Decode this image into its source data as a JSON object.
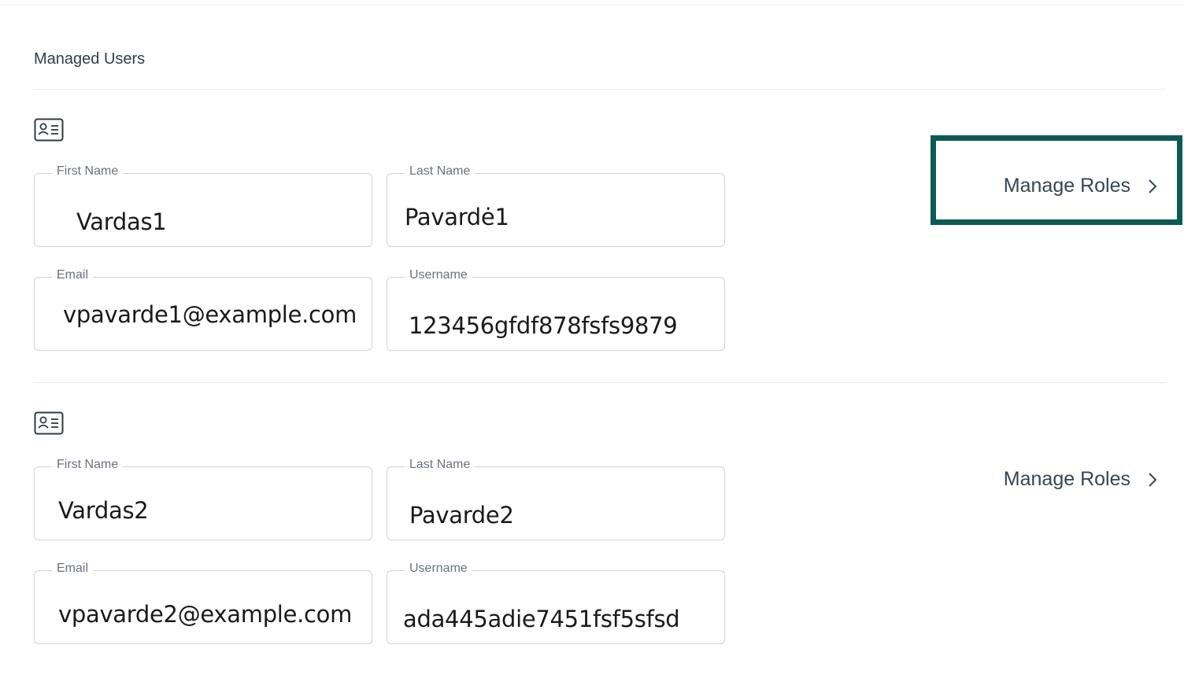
{
  "section": {
    "title": "Managed Users"
  },
  "labels": {
    "first_name": "First Name",
    "last_name": "Last Name",
    "email": "Email",
    "username": "Username",
    "manage_roles": "Manage Roles"
  },
  "users": [
    {
      "first_name": "Vardas1",
      "last_name": "Pavardė1",
      "email": "vpavarde1@example.com",
      "username": "123456gfdf878fsfs9879",
      "highlighted": true
    },
    {
      "first_name": "Vardas2",
      "last_name": "Pavarde2",
      "email": "vpavarde2@example.com",
      "username": "ada445adie7451fsf5sfsd",
      "highlighted": false
    }
  ],
  "colors": {
    "highlight": "#0b5b53",
    "field_border": "#cfd3d8",
    "label": "#6b7280",
    "link": "#354656"
  },
  "icons": {
    "user_card": "id-card-icon",
    "chevron": "chevron-right-icon"
  }
}
